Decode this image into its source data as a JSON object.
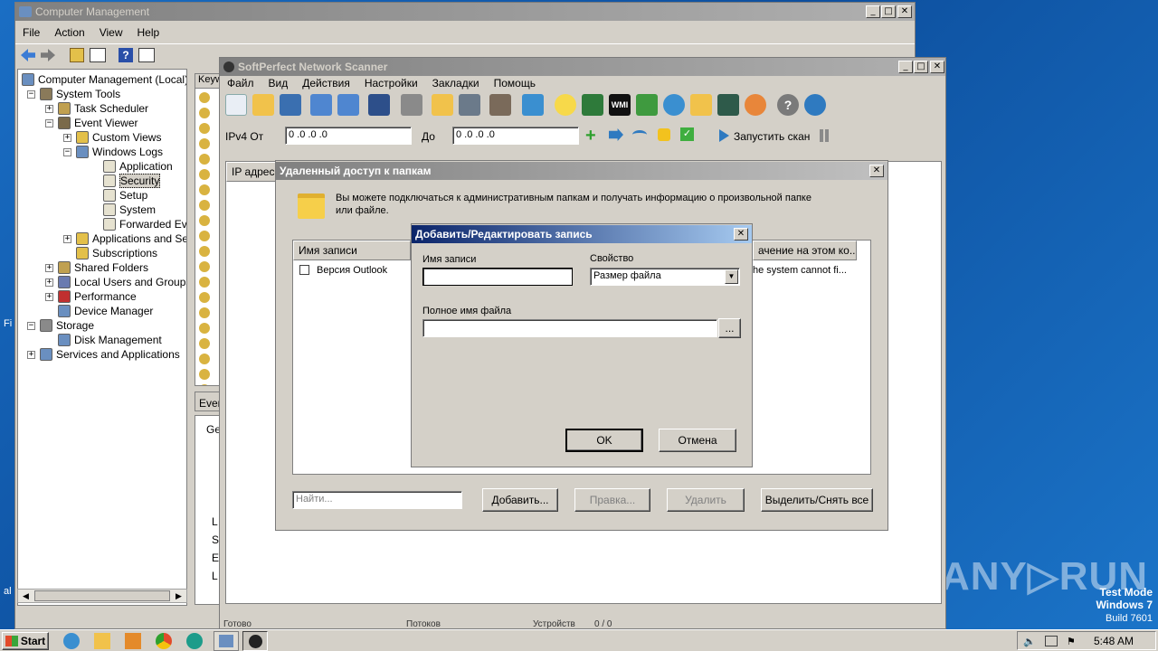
{
  "desktop": {
    "watermark": "ANY▷RUN",
    "test_mode_1": "Test Mode",
    "test_mode_2": "Windows 7",
    "test_mode_3": "Build 7601",
    "left_label_1": "Fi",
    "left_label_2": "al"
  },
  "cm": {
    "title": "Computer Management",
    "menu": [
      "File",
      "Action",
      "View",
      "Help"
    ],
    "tree": [
      {
        "label": "Computer Management (Local)",
        "exp": ""
      },
      {
        "label": "System Tools",
        "exp": "−"
      },
      {
        "label": "Task Scheduler",
        "exp": "+"
      },
      {
        "label": "Event Viewer",
        "exp": "−"
      },
      {
        "label": "Custom Views",
        "exp": "+"
      },
      {
        "label": "Windows Logs",
        "exp": "−"
      },
      {
        "label": "Application",
        "exp": ""
      },
      {
        "label": "Security",
        "exp": ""
      },
      {
        "label": "Setup",
        "exp": ""
      },
      {
        "label": "System",
        "exp": ""
      },
      {
        "label": "Forwarded Events",
        "exp": ""
      },
      {
        "label": "Applications and Servi",
        "exp": "+"
      },
      {
        "label": "Subscriptions",
        "exp": ""
      },
      {
        "label": "Shared Folders",
        "exp": "+"
      },
      {
        "label": "Local Users and Groups",
        "exp": "+"
      },
      {
        "label": "Performance",
        "exp": "+"
      },
      {
        "label": "Device Manager",
        "exp": ""
      },
      {
        "label": "Storage",
        "exp": "−"
      },
      {
        "label": "Disk Management",
        "exp": ""
      },
      {
        "label": "Services and Applications",
        "exp": "+"
      }
    ],
    "list_header": "Keyw",
    "lower_tab": "Even",
    "lower_general": "Ge",
    "lower_letters": [
      "L",
      "S",
      "E",
      "L"
    ]
  },
  "sp": {
    "title": "SoftPerfect Network Scanner",
    "menu": [
      "Файл",
      "Вид",
      "Действия",
      "Настройки",
      "Закладки",
      "Помощь"
    ],
    "ipv4_from_label": "IPv4 От",
    "ipv4_from_value": "0 .0 .0 .0",
    "ipv4_to_label": "До",
    "ipv4_to_value": "0 .0 .0 .0",
    "start_scan": "Запустить скан",
    "col_ip": "IP адрес",
    "status_bar": [
      "Готово",
      "Потоков",
      "Устройств",
      "0 / 0"
    ]
  },
  "remote": {
    "title": "Удаленный доступ к папкам",
    "description": "Вы можете подключаться к административным папкам и получать информацию о произвольной папке или файле.",
    "col_name": "Имя записи",
    "col_value": "ачение на этом ко...",
    "row_name": "Версия Outlook",
    "row_value": "he system cannot fi...",
    "search_placeholder": "Найти...",
    "add": "Добавить...",
    "edit": "Правка...",
    "delete": "Удалить",
    "select_all": "Выделить/Снять все"
  },
  "edit_dialog": {
    "title": "Добавить/Редактировать запись",
    "name_label": "Имя записи",
    "name_value": "",
    "property_label": "Свойство",
    "property_value": "Размер файла",
    "path_label": "Полное имя файла",
    "path_value": "",
    "browse": "...",
    "ok": "OK",
    "cancel": "Отмена"
  },
  "taskbar": {
    "start": "Start",
    "clock": "5:48 AM"
  }
}
